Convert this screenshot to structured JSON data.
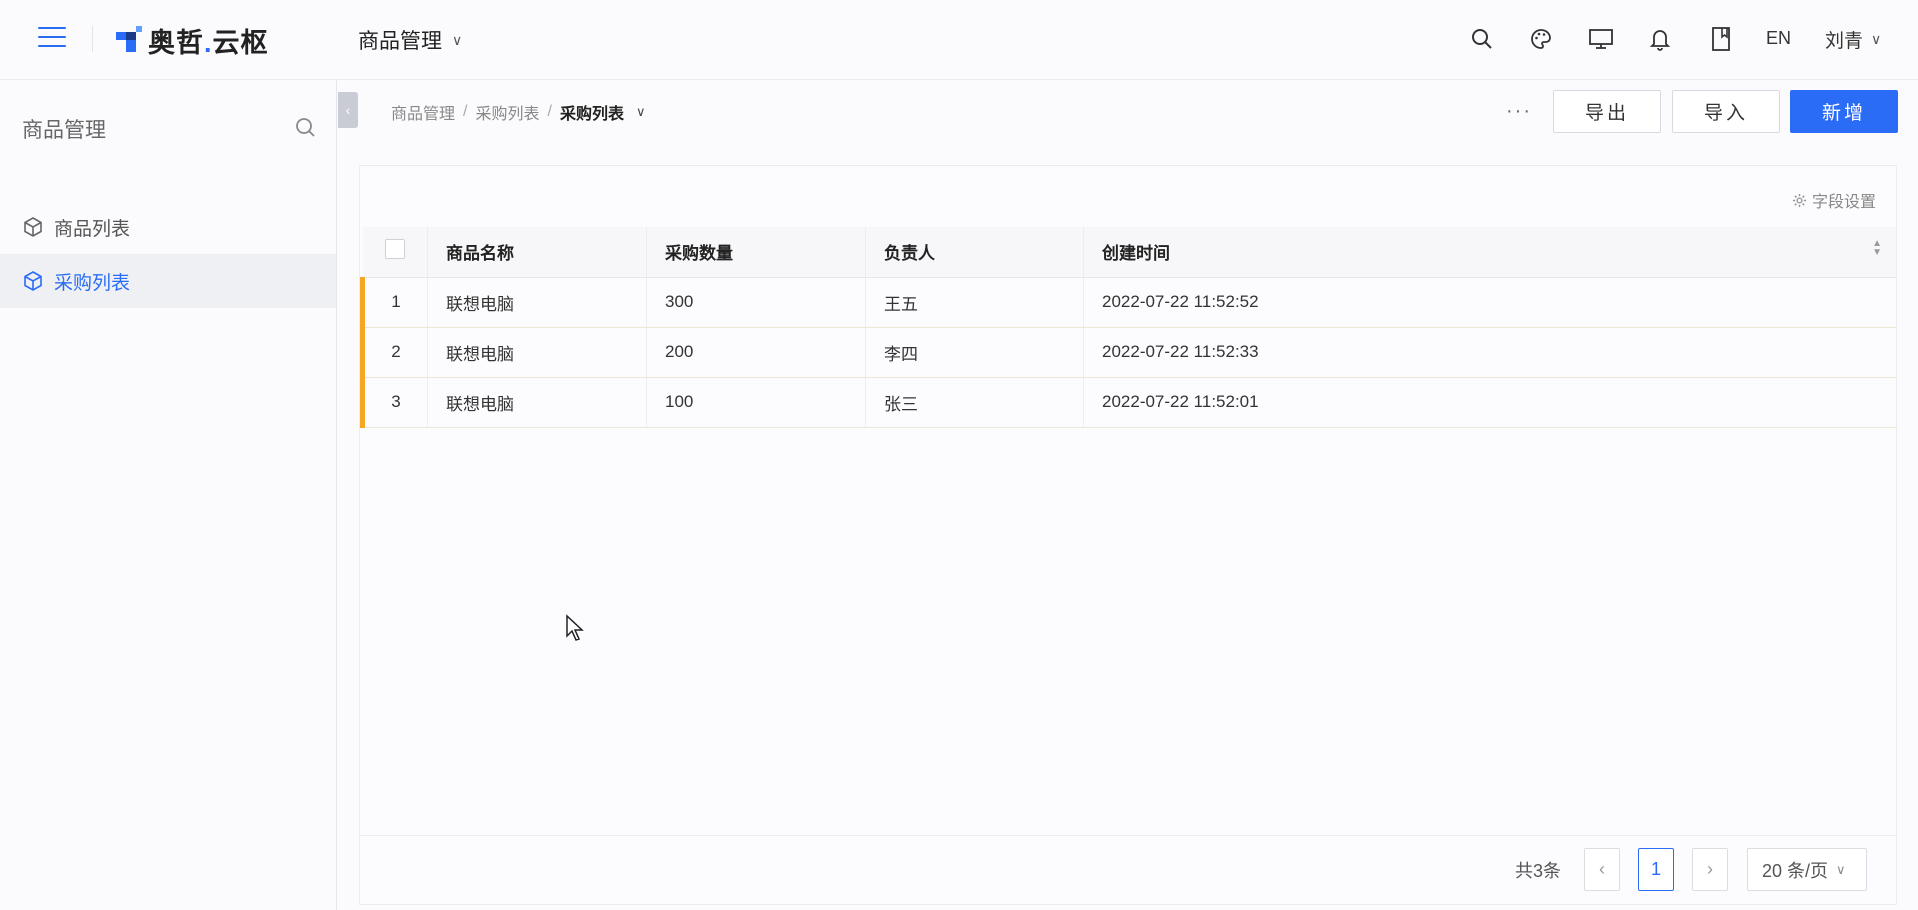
{
  "header": {
    "logo_text": "奥哲",
    "logo_dot": ".",
    "logo_text2": "云枢",
    "module": "商品管理",
    "lang": "EN",
    "user": "刘青",
    "accent": "#2b6cf6"
  },
  "sidebar": {
    "title": "商品管理",
    "items": [
      {
        "label": "商品列表",
        "icon": "cube-icon",
        "active": false
      },
      {
        "label": "采购列表",
        "icon": "cube-icon",
        "active": true
      }
    ]
  },
  "breadcrumb": {
    "items": [
      "商品管理",
      "采购列表"
    ],
    "current": "采购列表"
  },
  "toolbar": {
    "more": "···",
    "export_label": "导出",
    "import_label": "导入",
    "add_label": "新增"
  },
  "table": {
    "field_settings": "字段设置",
    "columns": [
      "商品名称",
      "采购数量",
      "负责人",
      "创建时间"
    ],
    "rows": [
      {
        "index": "1",
        "name": "联想电脑",
        "qty": "300",
        "owner": "王五",
        "created": "2022-07-22 11:52:52"
      },
      {
        "index": "2",
        "name": "联想电脑",
        "qty": "200",
        "owner": "李四",
        "created": "2022-07-22 11:52:33"
      },
      {
        "index": "3",
        "name": "联想电脑",
        "qty": "100",
        "owner": "张三",
        "created": "2022-07-22 11:52:01"
      }
    ],
    "row_marker_color": "#f5a623"
  },
  "pagination": {
    "total": "共3条",
    "current_page": "1",
    "page_size": "20 条/页"
  }
}
